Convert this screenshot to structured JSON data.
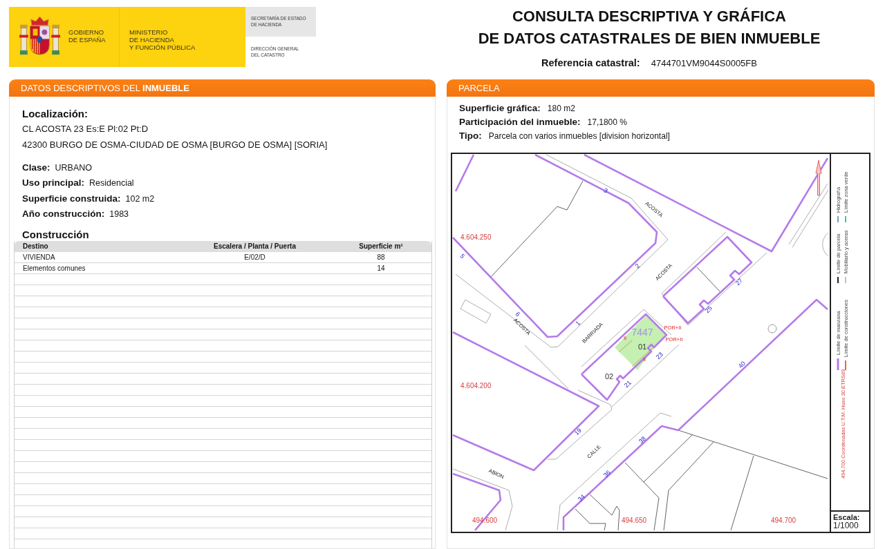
{
  "header": {
    "government": [
      "GOBIERNO",
      "DE ESPAÑA"
    ],
    "ministry": [
      "MINISTERIO",
      "DE HACIENDA",
      "Y FUNCIÓN PÚBLICA"
    ],
    "secretariat": [
      "SECRETARÍA DE ESTADO",
      "DE HACIENDA"
    ],
    "directorate": [
      "DIRECCIÓN GENERAL",
      "DEL CATASTRO"
    ]
  },
  "title": {
    "lines": [
      "CONSULTA DESCRIPTIVA Y GRÁFICA",
      "DE DATOS CATASTRALES DE BIEN INMUEBLE"
    ],
    "reference_label": "Referencia catastral:",
    "reference_value": "4744701VM9044S0005FB"
  },
  "property": {
    "title": "DATOS DESCRIPTIVOS DEL **INMUEBLE**",
    "location_label": "Localización:",
    "address_lines": [
      "CL ACOSTA 23 Es:E Pl:02 Pt:D",
      "42300 BURGO DE OSMA-CIUDAD DE OSMA [BURGO DE OSMA] [SORIA]"
    ],
    "fields": [
      {
        "label": "Clase:",
        "value": "URBANO"
      },
      {
        "label": "Uso principal:",
        "value": "Residencial"
      },
      {
        "label": "Superficie construida:",
        "value": "102 m2"
      },
      {
        "label": "Año construcción:",
        "value": "1983"
      }
    ],
    "construction": {
      "title": "Construcción",
      "columns": [
        "Destino",
        "Escalera / Planta / Puerta",
        "Superficie m²"
      ],
      "rows": [
        {
          "destino": "VIVIENDA",
          "escalera_planta_puerta": "E/02/D",
          "superficie": "88"
        },
        {
          "destino": "Elementos comunes",
          "superficie": "14"
        }
      ]
    }
  },
  "parcel": {
    "title": "PARCELA",
    "fields": [
      {
        "label": "Superficie gráfica:",
        "value": "180 m2"
      },
      {
        "label": "Participación del inmueble:",
        "value": "17,1800 %"
      },
      {
        "label": "Tipo:",
        "value": "Parcela con varios inmuebles [division horizontal]"
      }
    ],
    "map": {
      "labels": [
        {
          "kind": "house_number",
          "text": "3"
        },
        {
          "kind": "street",
          "text": "ACOSTA"
        },
        {
          "kind": "coordinate",
          "text": "4.604.250"
        },
        {
          "kind": "house_number",
          "text": "5"
        },
        {
          "kind": "house_number",
          "text": "2"
        },
        {
          "kind": "street",
          "text": "ACOSTA"
        },
        {
          "kind": "house_number",
          "text": "27"
        },
        {
          "kind": "house_number",
          "text": "25"
        },
        {
          "kind": "house_number",
          "text": "6"
        },
        {
          "kind": "house_number",
          "text": "1"
        },
        {
          "kind": "street",
          "text": "ACOSTA"
        },
        {
          "kind": "annotation",
          "text": "POR+II"
        },
        {
          "kind": "parcel_ref",
          "text": "7447"
        },
        {
          "kind": "street",
          "text": "BARRIADA"
        },
        {
          "kind": "annotation",
          "text": "II"
        },
        {
          "kind": "annotation",
          "text": "POR+II"
        },
        {
          "kind": "plot",
          "text": "01"
        },
        {
          "kind": "house_number",
          "text": "23"
        },
        {
          "kind": "annotation",
          "text": "II"
        },
        {
          "kind": "house_number",
          "text": "40"
        },
        {
          "kind": "plot",
          "text": "02"
        },
        {
          "kind": "house_number",
          "text": "21"
        },
        {
          "kind": "coordinate",
          "text": "4.604.200"
        },
        {
          "kind": "house_number",
          "text": "19"
        },
        {
          "kind": "house_number",
          "text": "38"
        },
        {
          "kind": "street",
          "text": "CALLE"
        },
        {
          "kind": "house_number",
          "text": "36"
        },
        {
          "kind": "street",
          "text": "ABION"
        },
        {
          "kind": "house_number",
          "text": "34"
        },
        {
          "kind": "coordinate",
          "text": "494.600"
        },
        {
          "kind": "coordinate",
          "text": "494.650"
        },
        {
          "kind": "coordinate",
          "text": "494.700"
        }
      ],
      "legend": [
        {
          "label": "Límite de manzana",
          "color": "#b57be8"
        },
        {
          "label": "Límite de parcela",
          "color": "#222222"
        },
        {
          "label": "Hidrografía",
          "color": "#7a9cc8"
        },
        {
          "label": "Límite de construcciones",
          "color": "#e06a4a"
        },
        {
          "label": "Mobiliario y aceras",
          "color": "#c0c0c0"
        },
        {
          "label": "Límite zona verde",
          "color": "#3cc8a8"
        }
      ],
      "coordinates_note": "494.700 Coordenadas U.T.M. Huso 30 ETRS89",
      "scale_label": "Escala:",
      "scale_value": "1/1000"
    }
  }
}
